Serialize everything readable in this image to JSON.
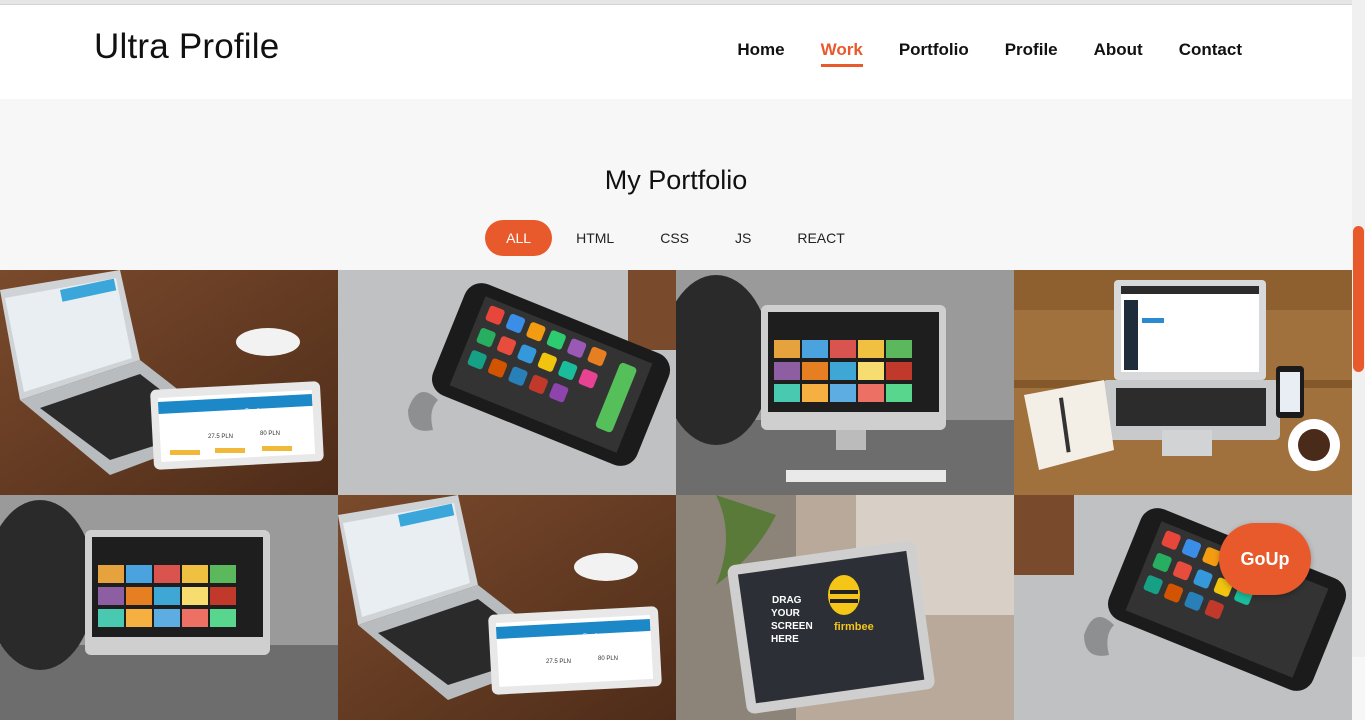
{
  "brand": "Ultra Profile",
  "nav": {
    "items": [
      "Home",
      "Work",
      "Portfolio",
      "Profile",
      "About",
      "Contact"
    ],
    "active": "Work"
  },
  "portfolio": {
    "title": "My Portfolio",
    "filters": [
      "ALL",
      "HTML",
      "CSS",
      "JS",
      "REACT"
    ],
    "active_filter": "ALL"
  },
  "tiles": [
    {
      "type": "macbook-ipad",
      "ipad_price1": "27.5 PLN",
      "ipad_price2": "80 PLN",
      "ipad_title": "Cennik"
    },
    {
      "type": "iphone"
    },
    {
      "type": "imac-person"
    },
    {
      "type": "laptop-desk"
    },
    {
      "type": "imac-person"
    },
    {
      "type": "macbook-ipad",
      "ipad_price1": "27.5 PLN",
      "ipad_price2": "80 PLN",
      "ipad_title": "Cennik"
    },
    {
      "type": "laptop-firmbee",
      "text": "DRAG YOUR SCREEN HERE",
      "logo": "firmbee"
    },
    {
      "type": "iphone"
    }
  ],
  "goup_label": "GoUp",
  "colors": {
    "accent": "#e85a2c",
    "header_bg": "#ffffff",
    "page_bg": "#f7f7f7"
  }
}
